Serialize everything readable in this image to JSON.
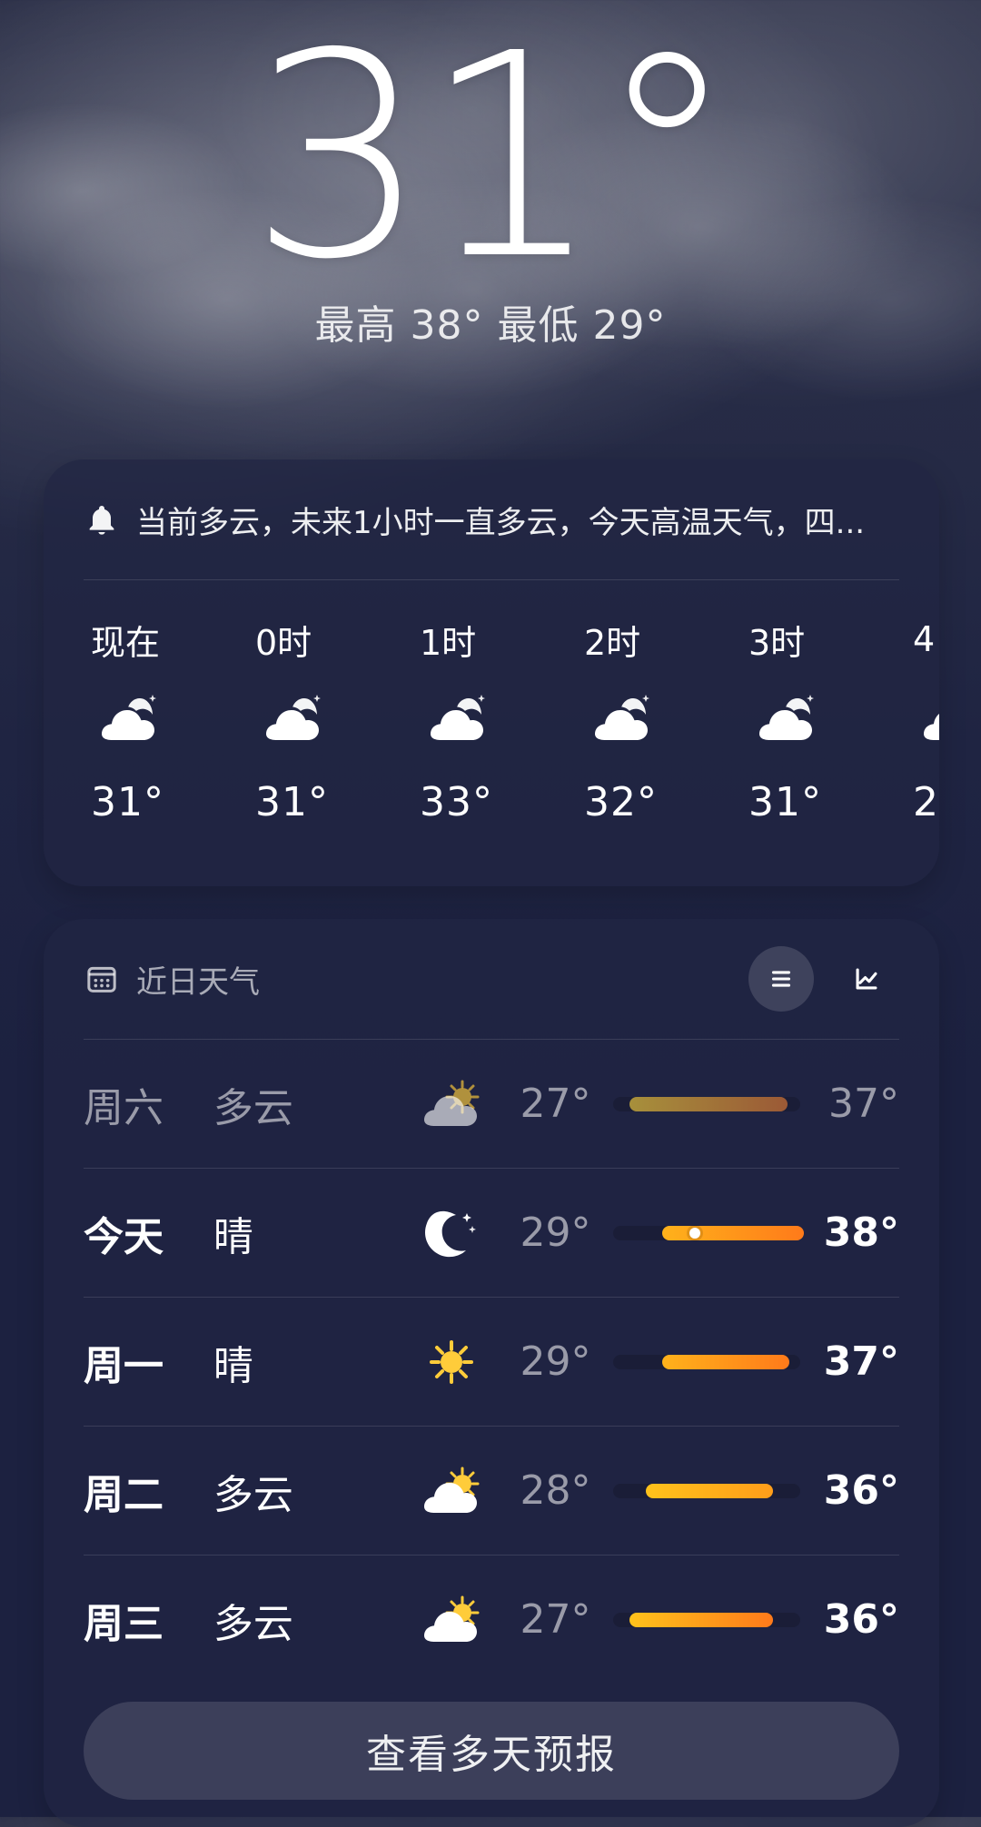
{
  "current": {
    "temperature": "31°",
    "hi_lo": "最高 38° 最低 29°"
  },
  "alert": {
    "icon": "bell-icon",
    "text": "当前多云，未来1小时一直多云，今天高温天气，四..."
  },
  "hourly": [
    {
      "label": "现在",
      "icon": "cloud-moon-icon",
      "temp": "31°"
    },
    {
      "label": "0时",
      "icon": "cloud-moon-icon",
      "temp": "31°"
    },
    {
      "label": "1时",
      "icon": "cloud-moon-icon",
      "temp": "33°"
    },
    {
      "label": "2时",
      "icon": "cloud-moon-icon",
      "temp": "32°"
    },
    {
      "label": "3时",
      "icon": "cloud-moon-icon",
      "temp": "31°"
    },
    {
      "label": "4",
      "icon": "cloud-moon-icon",
      "temp": "2"
    }
  ],
  "daily": {
    "title": "近日天气",
    "title_icon": "calendar-icon",
    "view_buttons": [
      {
        "icon": "list-icon",
        "active": true
      },
      {
        "icon": "line-chart-icon",
        "active": false
      }
    ],
    "rows": [
      {
        "day": "周六",
        "condition": "多云",
        "icon": "cloud-sun-icon",
        "low": "27°",
        "high": "37°",
        "muted": true
      },
      {
        "day": "今天",
        "condition": "晴",
        "icon": "moon-stars-icon",
        "low": "29°",
        "high": "38°",
        "muted": false
      },
      {
        "day": "周一",
        "condition": "晴",
        "icon": "sun-icon",
        "low": "29°",
        "high": "37°",
        "muted": false
      },
      {
        "day": "周二",
        "condition": "多云",
        "icon": "cloud-sun-icon",
        "low": "28°",
        "high": "36°",
        "muted": false
      },
      {
        "day": "周三",
        "condition": "多云",
        "icon": "cloud-sun-icon",
        "low": "27°",
        "high": "36°",
        "muted": false
      }
    ],
    "cta": "查看多天预报"
  }
}
